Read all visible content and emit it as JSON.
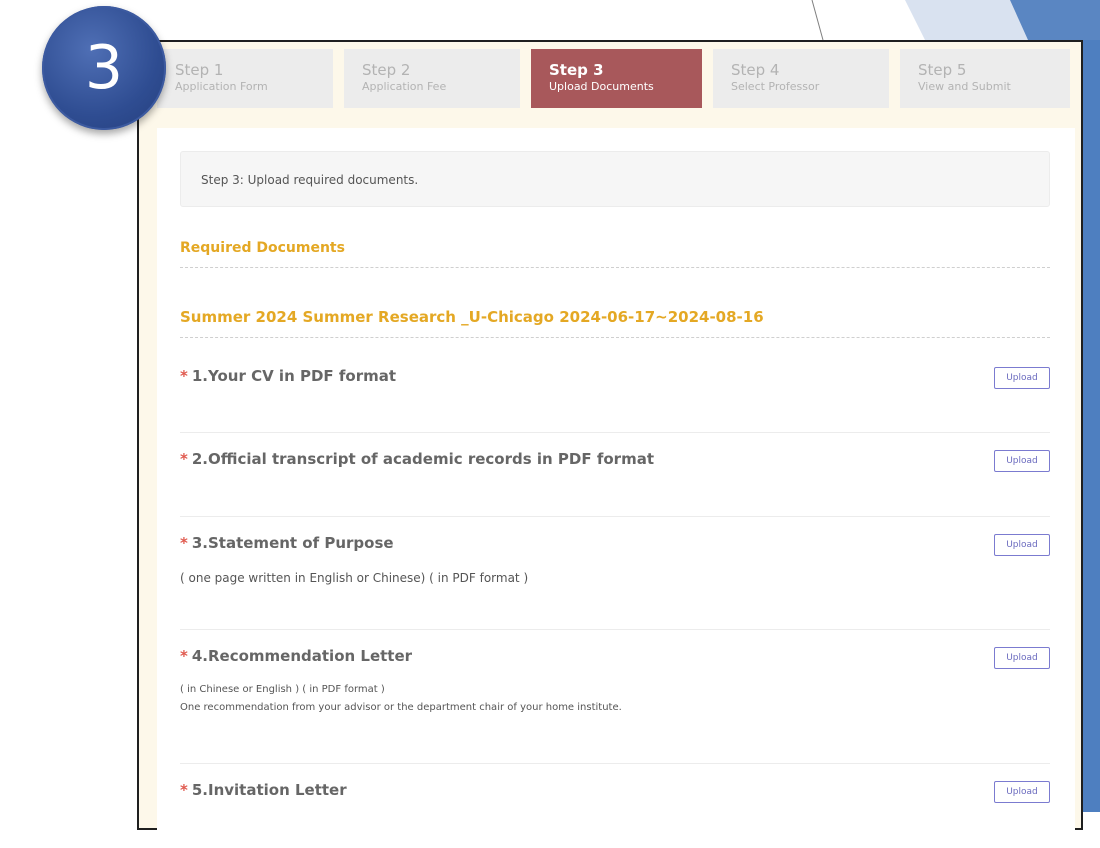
{
  "badge": {
    "number": "3"
  },
  "steps": [
    {
      "label": "Step 1",
      "sub": "Application Form"
    },
    {
      "label": "Step 2",
      "sub": "Application Fee"
    },
    {
      "label": "Step 3",
      "sub": "Upload Documents"
    },
    {
      "label": "Step 4",
      "sub": "Select Professor"
    },
    {
      "label": "Step 5",
      "sub": "View and Submit"
    }
  ],
  "active_step": 3,
  "notice": "Step 3: Upload required documents.",
  "required_heading": "Required Documents",
  "program_heading": "Summer 2024 Summer Research _U-Chicago 2024-06-17~2024-08-16",
  "upload_label": "Upload",
  "required_marker": "*",
  "documents": [
    {
      "title": "1.Your CV in PDF format",
      "notes": []
    },
    {
      "title": "2.Official transcript of academic records in PDF format",
      "notes": []
    },
    {
      "title": "3.Statement of Purpose",
      "notes": [
        "( one page written in English or Chinese) ( in PDF format )"
      ]
    },
    {
      "title": "4.Recommendation Letter",
      "notes": [
        "( in Chinese or English ) ( in PDF format )",
        "One recommendation from your advisor or the department chair of your home institute."
      ]
    },
    {
      "title": "5.Invitation Letter",
      "notes": []
    }
  ],
  "colors": {
    "active_step": "#a8585b",
    "heading": "#e4a824",
    "badge": "#2f4d92",
    "upload_border": "#7b7bd0",
    "required_star": "#e05a4f"
  }
}
